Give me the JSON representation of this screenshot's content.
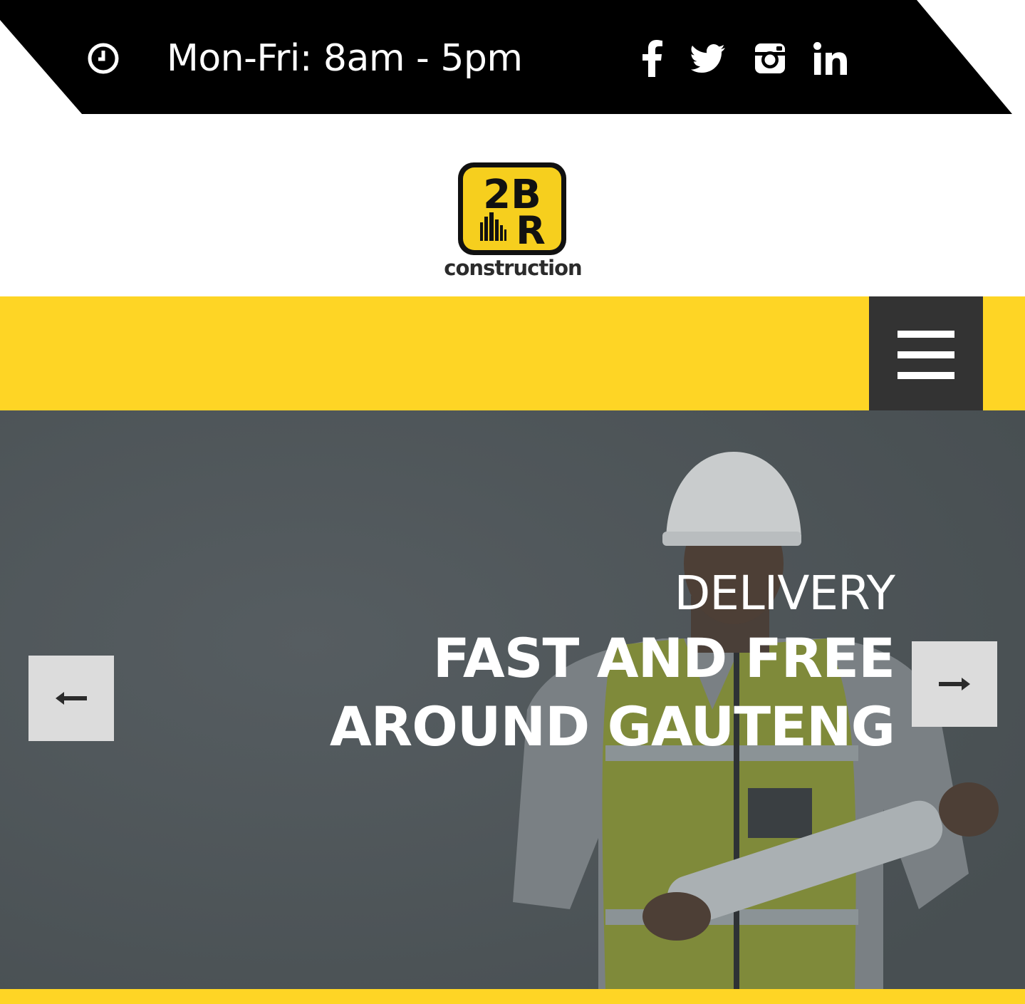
{
  "topbar": {
    "hours_text": "Mon-Fri: 8am - 5pm",
    "hours_icon": "clock-icon",
    "social": [
      {
        "name": "facebook",
        "icon": "facebook-icon"
      },
      {
        "name": "twitter",
        "icon": "twitter-icon"
      },
      {
        "name": "instagram",
        "icon": "instagram-icon"
      },
      {
        "name": "linkedin",
        "icon": "linkedin-icon"
      }
    ]
  },
  "logo": {
    "line1": "2B",
    "line2": "R",
    "wordmark": "construction"
  },
  "nav": {
    "menu_icon": "hamburger-menu-icon"
  },
  "hero": {
    "subtitle": "DELIVERY",
    "title_line1": "FAST AND FREE",
    "title_line2": "AROUND GAUTENG",
    "prev_icon": "arrow-left-icon",
    "next_icon": "arrow-right-icon"
  },
  "colors": {
    "accent": "#fed525",
    "dark": "#000000",
    "menu_bg": "#333333",
    "arrow_bg": "#dcdcdc"
  }
}
